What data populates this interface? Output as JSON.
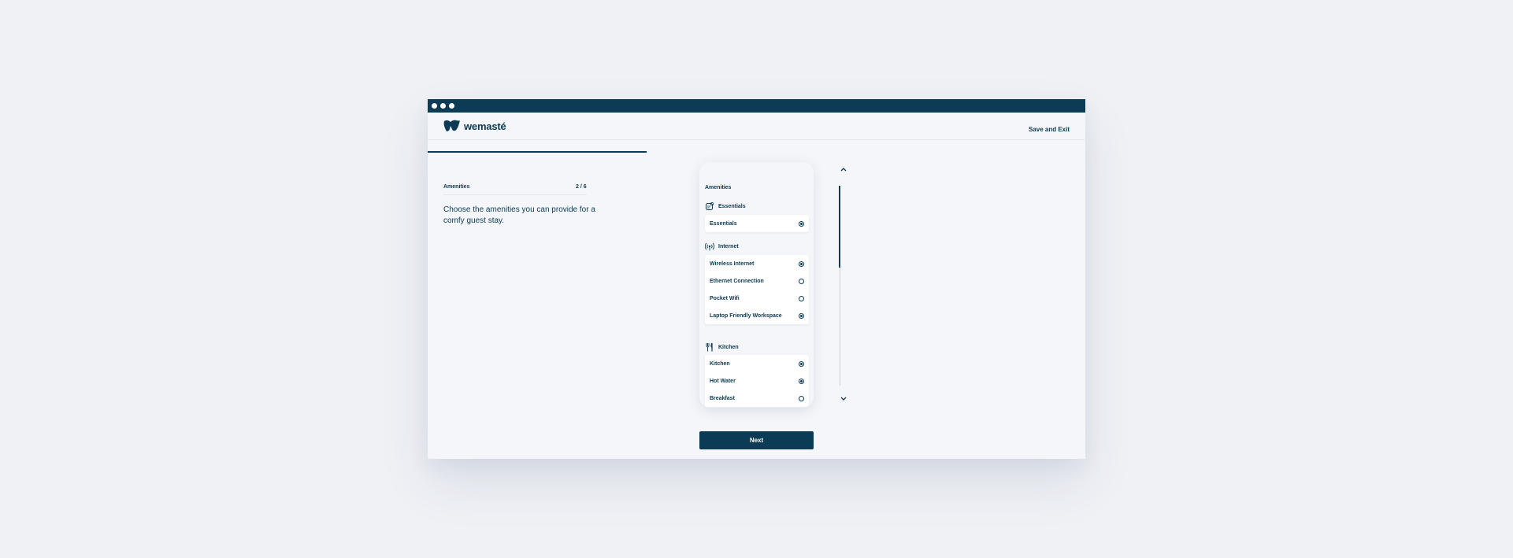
{
  "app": {
    "brand": "wemasté",
    "save_exit_label": "Save and Exit",
    "progress_fraction": 0.333
  },
  "step": {
    "title": "Amenities",
    "counter": "2 / 6",
    "description": "Choose the amenities you can provide for a comfy guest stay."
  },
  "preview": {
    "title": "Amenities",
    "sections": [
      {
        "name": "Essentials",
        "icon": "soap-icon",
        "items": [
          {
            "label": "Essentials",
            "selected": true
          }
        ]
      },
      {
        "name": "Internet",
        "icon": "wifi-signal-icon",
        "items": [
          {
            "label": "Wireless Internet",
            "selected": true
          },
          {
            "label": "Ethernet Connection",
            "selected": false
          },
          {
            "label": "Pocket Wifi",
            "selected": false
          },
          {
            "label": "Laptop Friendly Workspace",
            "selected": true
          }
        ]
      },
      {
        "name": "Kitchen",
        "icon": "fork-knife-icon",
        "items": [
          {
            "label": "Kitchen",
            "selected": true
          },
          {
            "label": "Hot Water",
            "selected": true
          },
          {
            "label": "Breakfast",
            "selected": false
          }
        ]
      }
    ]
  },
  "actions": {
    "next_label": "Next"
  },
  "colors": {
    "brand": "#0c3c55",
    "background": "#eff1f5",
    "surface": "#f4f6f9"
  }
}
